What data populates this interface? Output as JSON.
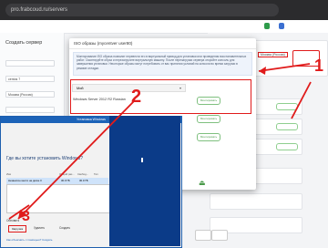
{
  "browser": {
    "url": "pro.frabcoud.ru/servers"
  },
  "appbar": {
    "user_name": "",
    "badges": [
      {
        "text": "",
        "color": "#2e9b4a"
      },
      {
        "text": "",
        "color": "#3b6fd1"
      }
    ]
  },
  "left": {
    "title": "Создать сервер",
    "fields": [
      {
        "label": "",
        "value": ""
      },
      {
        "label": "",
        "value": "centos 7"
      },
      {
        "label": "",
        "value": "Москва (Россия)"
      },
      {
        "label": "",
        "value": ""
      }
    ]
  },
  "right": {
    "rows": [
      {
        "text": "",
        "status": ""
      },
      {
        "text": "",
        "status": ""
      },
      {
        "text": "",
        "status": ""
      },
      {
        "text": "",
        "status": ""
      }
    ],
    "highlight_text": "Москва (Россия)"
  },
  "modal": {
    "title": "ISO образы (mycentver user80)",
    "notice": "Монтирование ISO образа позволит перевести его в виртуальный привод для установки или проведения восстановительных работ. Смонтируйте образ и перезагрузите виртуальную машину. После перезагрузки сервера откройте консоль для завершения установки. Некоторые образы могут потребовать от вас принятия условий на консоли во время загрузки в режиме отладки.",
    "section_label": "",
    "select_label": "Мой",
    "item_label": "Windows Server 2012 R2 Russian",
    "mount_label": "Монтировать",
    "row_actions": [
      "Монтировать",
      "Монтировать"
    ]
  },
  "win_dialog": {
    "title": "Установка Windows",
    "question": "Где вы хотите установить Windows?",
    "columns": [
      "Имя",
      "Общий раз...",
      "Свобод...",
      "Тип"
    ],
    "row": [
      "Незанятое место на диске 0",
      "30.0 ГБ",
      "30.0 ГБ",
      ""
    ],
    "buttons": [
      "Обновить",
      "Загрузка",
      "Удалить",
      "Создать"
    ],
    "footer_link": "Как объяснить с помощью? Создать"
  },
  "annotations": [
    "1",
    "2",
    "3"
  ],
  "colors": {
    "annotation": "#e01b1b",
    "accent_green": "#4a9a4a",
    "win_blue": "#1c63b8"
  }
}
